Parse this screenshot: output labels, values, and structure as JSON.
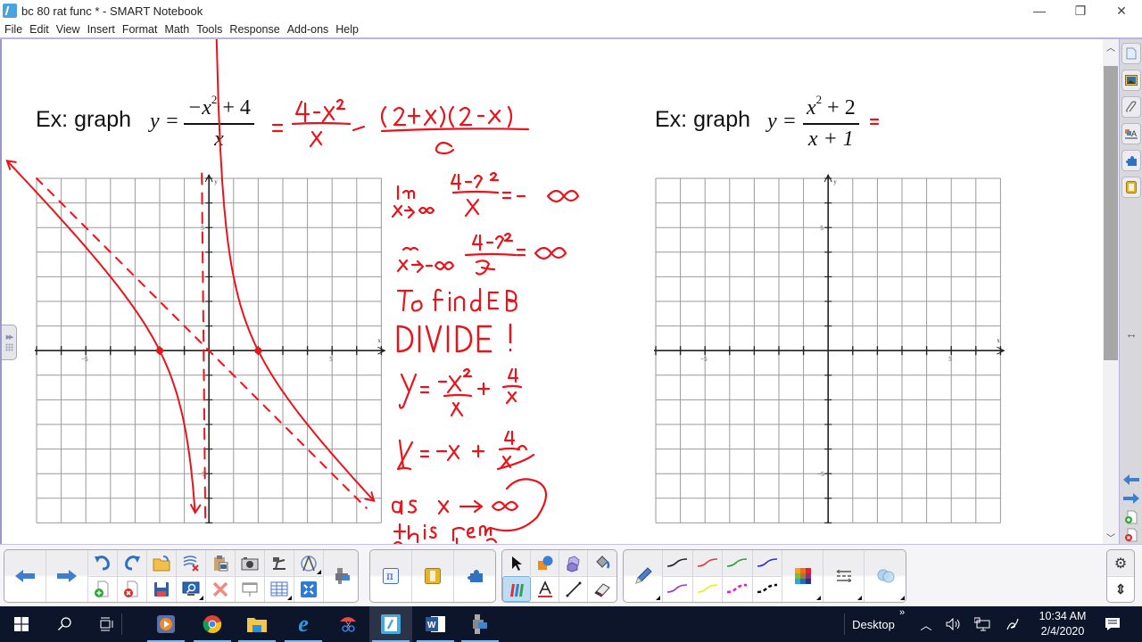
{
  "window": {
    "title": "bc 80 rat func * - SMART Notebook",
    "controls": {
      "minimize": "—",
      "restore": "❐",
      "close": "✕"
    }
  },
  "menu": [
    "File",
    "Edit",
    "View",
    "Insert",
    "Format",
    "Math",
    "Tools",
    "Response",
    "Add-ons",
    "Help"
  ],
  "page": {
    "example1": {
      "label": "Ex: graph",
      "equation_lhs": "y =",
      "numerator": "−x² + 4",
      "numerator_base": "−x",
      "numerator_exp": "2",
      "numerator_rest": " + 4",
      "denominator": "x",
      "handwritten_rewrite": [
        "= (4 − x²)/x",
        "= (2 + x)(2 − x)/x"
      ]
    },
    "example2": {
      "label": "Ex: graph",
      "equation_lhs": "y =",
      "numerator": "x² + 2",
      "numerator_base": "x",
      "numerator_exp": "2",
      "numerator_rest": " + 2",
      "denominator": "x + 1",
      "handwritten_mark": "="
    },
    "handwritten_notes": [
      "lim x→∞ (4 − x²)/x = −∞",
      "lim x→−∞ (4 − x²)/x = ∞",
      "To find EB",
      "DIVIDE !",
      "y = −x²/x + 4/x",
      "y = −x + 4/x",
      "as x → ∞",
      "this rem..."
    ],
    "graph1": {
      "axis_labels": {
        "x": "x",
        "y": "y"
      },
      "tick_labels": {
        "x_neg": "−5",
        "x_pos": "5",
        "y_pos": "5",
        "y_neg": "−5"
      },
      "ink_color": "#e8141b",
      "features": {
        "x_intercepts": [
          -2,
          2
        ],
        "vertical_asymptote": "x = 0",
        "slant_asymptote": "y = −x"
      }
    },
    "graph2": {
      "axis_labels": {
        "x": "x",
        "y": "y"
      },
      "tick_labels": {
        "x_neg": "−5",
        "x_pos": "5",
        "y_pos": "5",
        "y_neg": "−5"
      }
    }
  },
  "right_tabs": [
    "page-sorter",
    "gallery",
    "attachments",
    "properties",
    "add-ons",
    "response"
  ],
  "right_controls": {
    "resize": "↔",
    "prev_page": "previous-page",
    "next_page": "next-page",
    "add_page": "add-page",
    "delete_page": "delete-page"
  },
  "toolbar": {
    "nav": [
      "previous-page",
      "next-page"
    ],
    "top_row": [
      "undo",
      "redo",
      "open-file",
      "clear-ink",
      "paste",
      "screen-capture",
      "document-camera",
      "measurement-tools"
    ],
    "bottom_row": [
      "add-page",
      "delete-page",
      "save",
      "screen-shade",
      "delete",
      "full-screen",
      "table",
      "smart-response"
    ],
    "extra": [
      "video-camera"
    ],
    "math_group": [
      "math-tools",
      "response-tool",
      "add-ons"
    ],
    "select_group_top": [
      "select",
      "shapes",
      "regular-polygons",
      "fill"
    ],
    "select_group_bottom": [
      "pens",
      "text",
      "lines",
      "eraser"
    ],
    "pen_tool": "pen",
    "pen_colors": [
      {
        "name": "black-pen",
        "color": "#222222"
      },
      {
        "name": "red-pen",
        "color": "#e8383a"
      },
      {
        "name": "green-pen",
        "color": "#2f9e3a"
      },
      {
        "name": "blue-pen",
        "color": "#2a33c9"
      },
      {
        "name": "purple-pen",
        "color": "#a436b8"
      },
      {
        "name": "yellow-pen",
        "color": "#f2ec1c"
      },
      {
        "name": "magenta-dashed-pen",
        "color": "#e01ad0"
      },
      {
        "name": "black-dashed-pen",
        "color": "#111111"
      }
    ],
    "more": [
      "color-palette",
      "line-style",
      "transparency"
    ],
    "right": [
      "settings",
      "move-toolbar"
    ]
  },
  "taskbar": {
    "apps": [
      "start",
      "search",
      "task-view",
      "media-player",
      "chrome",
      "file-explorer",
      "internet-explorer",
      "snipping-tool",
      "smart-notebook",
      "word",
      "document-camera"
    ],
    "desktop_label": "Desktop",
    "overflow": "»",
    "time": "10:34 AM",
    "date": "2/4/2020"
  }
}
